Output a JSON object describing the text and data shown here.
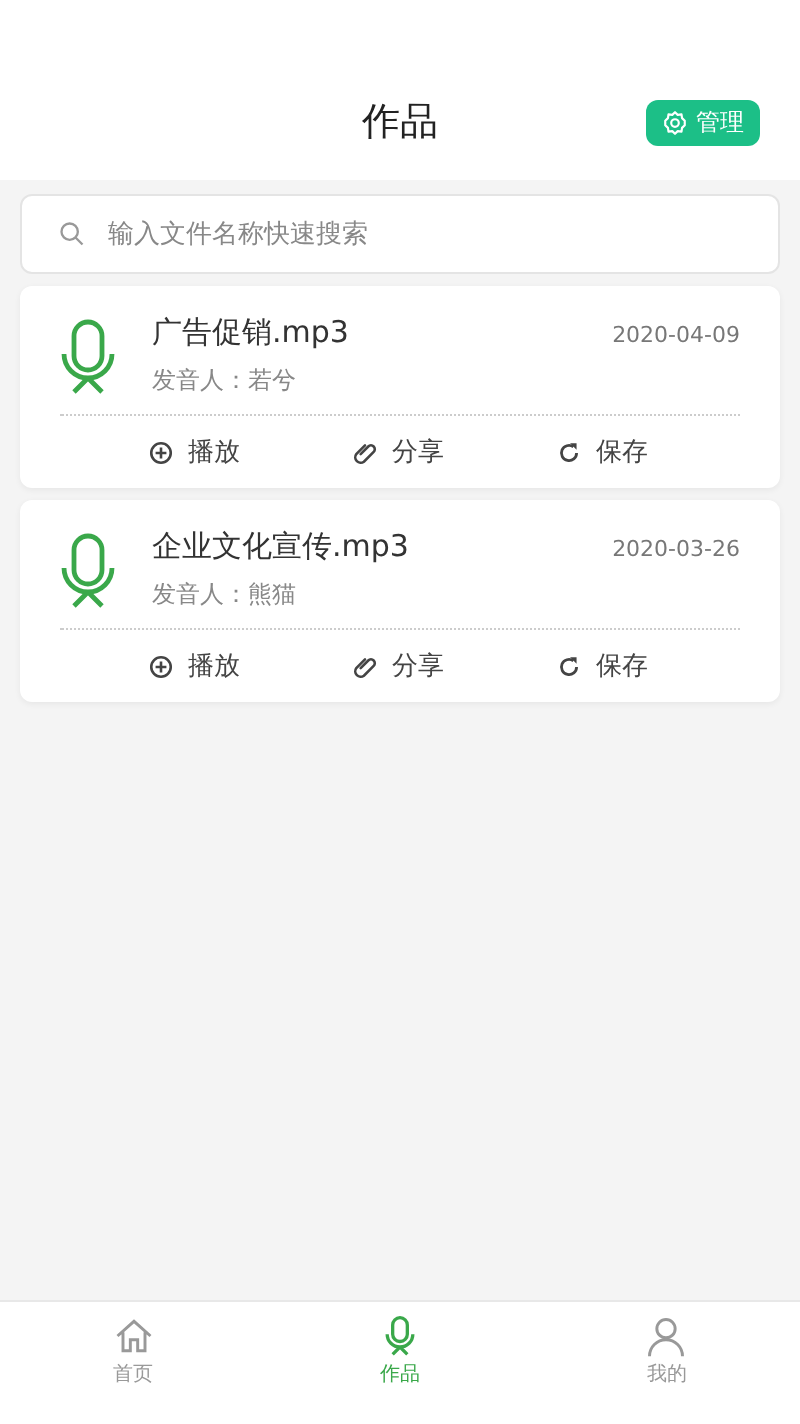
{
  "header": {
    "title": "作品",
    "manage_button": "管理"
  },
  "search": {
    "placeholder": "输入文件名称快速搜索"
  },
  "works": [
    {
      "name": "广告促销.mp3",
      "date": "2020-04-09",
      "speaker": "发音人：若兮",
      "actions": [
        {
          "kind": "play",
          "label": "播放"
        },
        {
          "kind": "share",
          "label": "分享"
        },
        {
          "kind": "save",
          "label": "保存"
        }
      ]
    },
    {
      "name": "企业文化宣传.mp3",
      "date": "2020-03-26",
      "speaker": "发音人：熊猫",
      "actions": [
        {
          "kind": "play",
          "label": "播放"
        },
        {
          "kind": "share",
          "label": "分享"
        },
        {
          "kind": "save",
          "label": "保存"
        }
      ]
    }
  ],
  "tab_bar": [
    {
      "kind": "home",
      "label": "首页",
      "selected": false
    },
    {
      "kind": "mic",
      "label": "作品",
      "selected": true
    },
    {
      "kind": "user",
      "label": "我的",
      "selected": false
    }
  ]
}
